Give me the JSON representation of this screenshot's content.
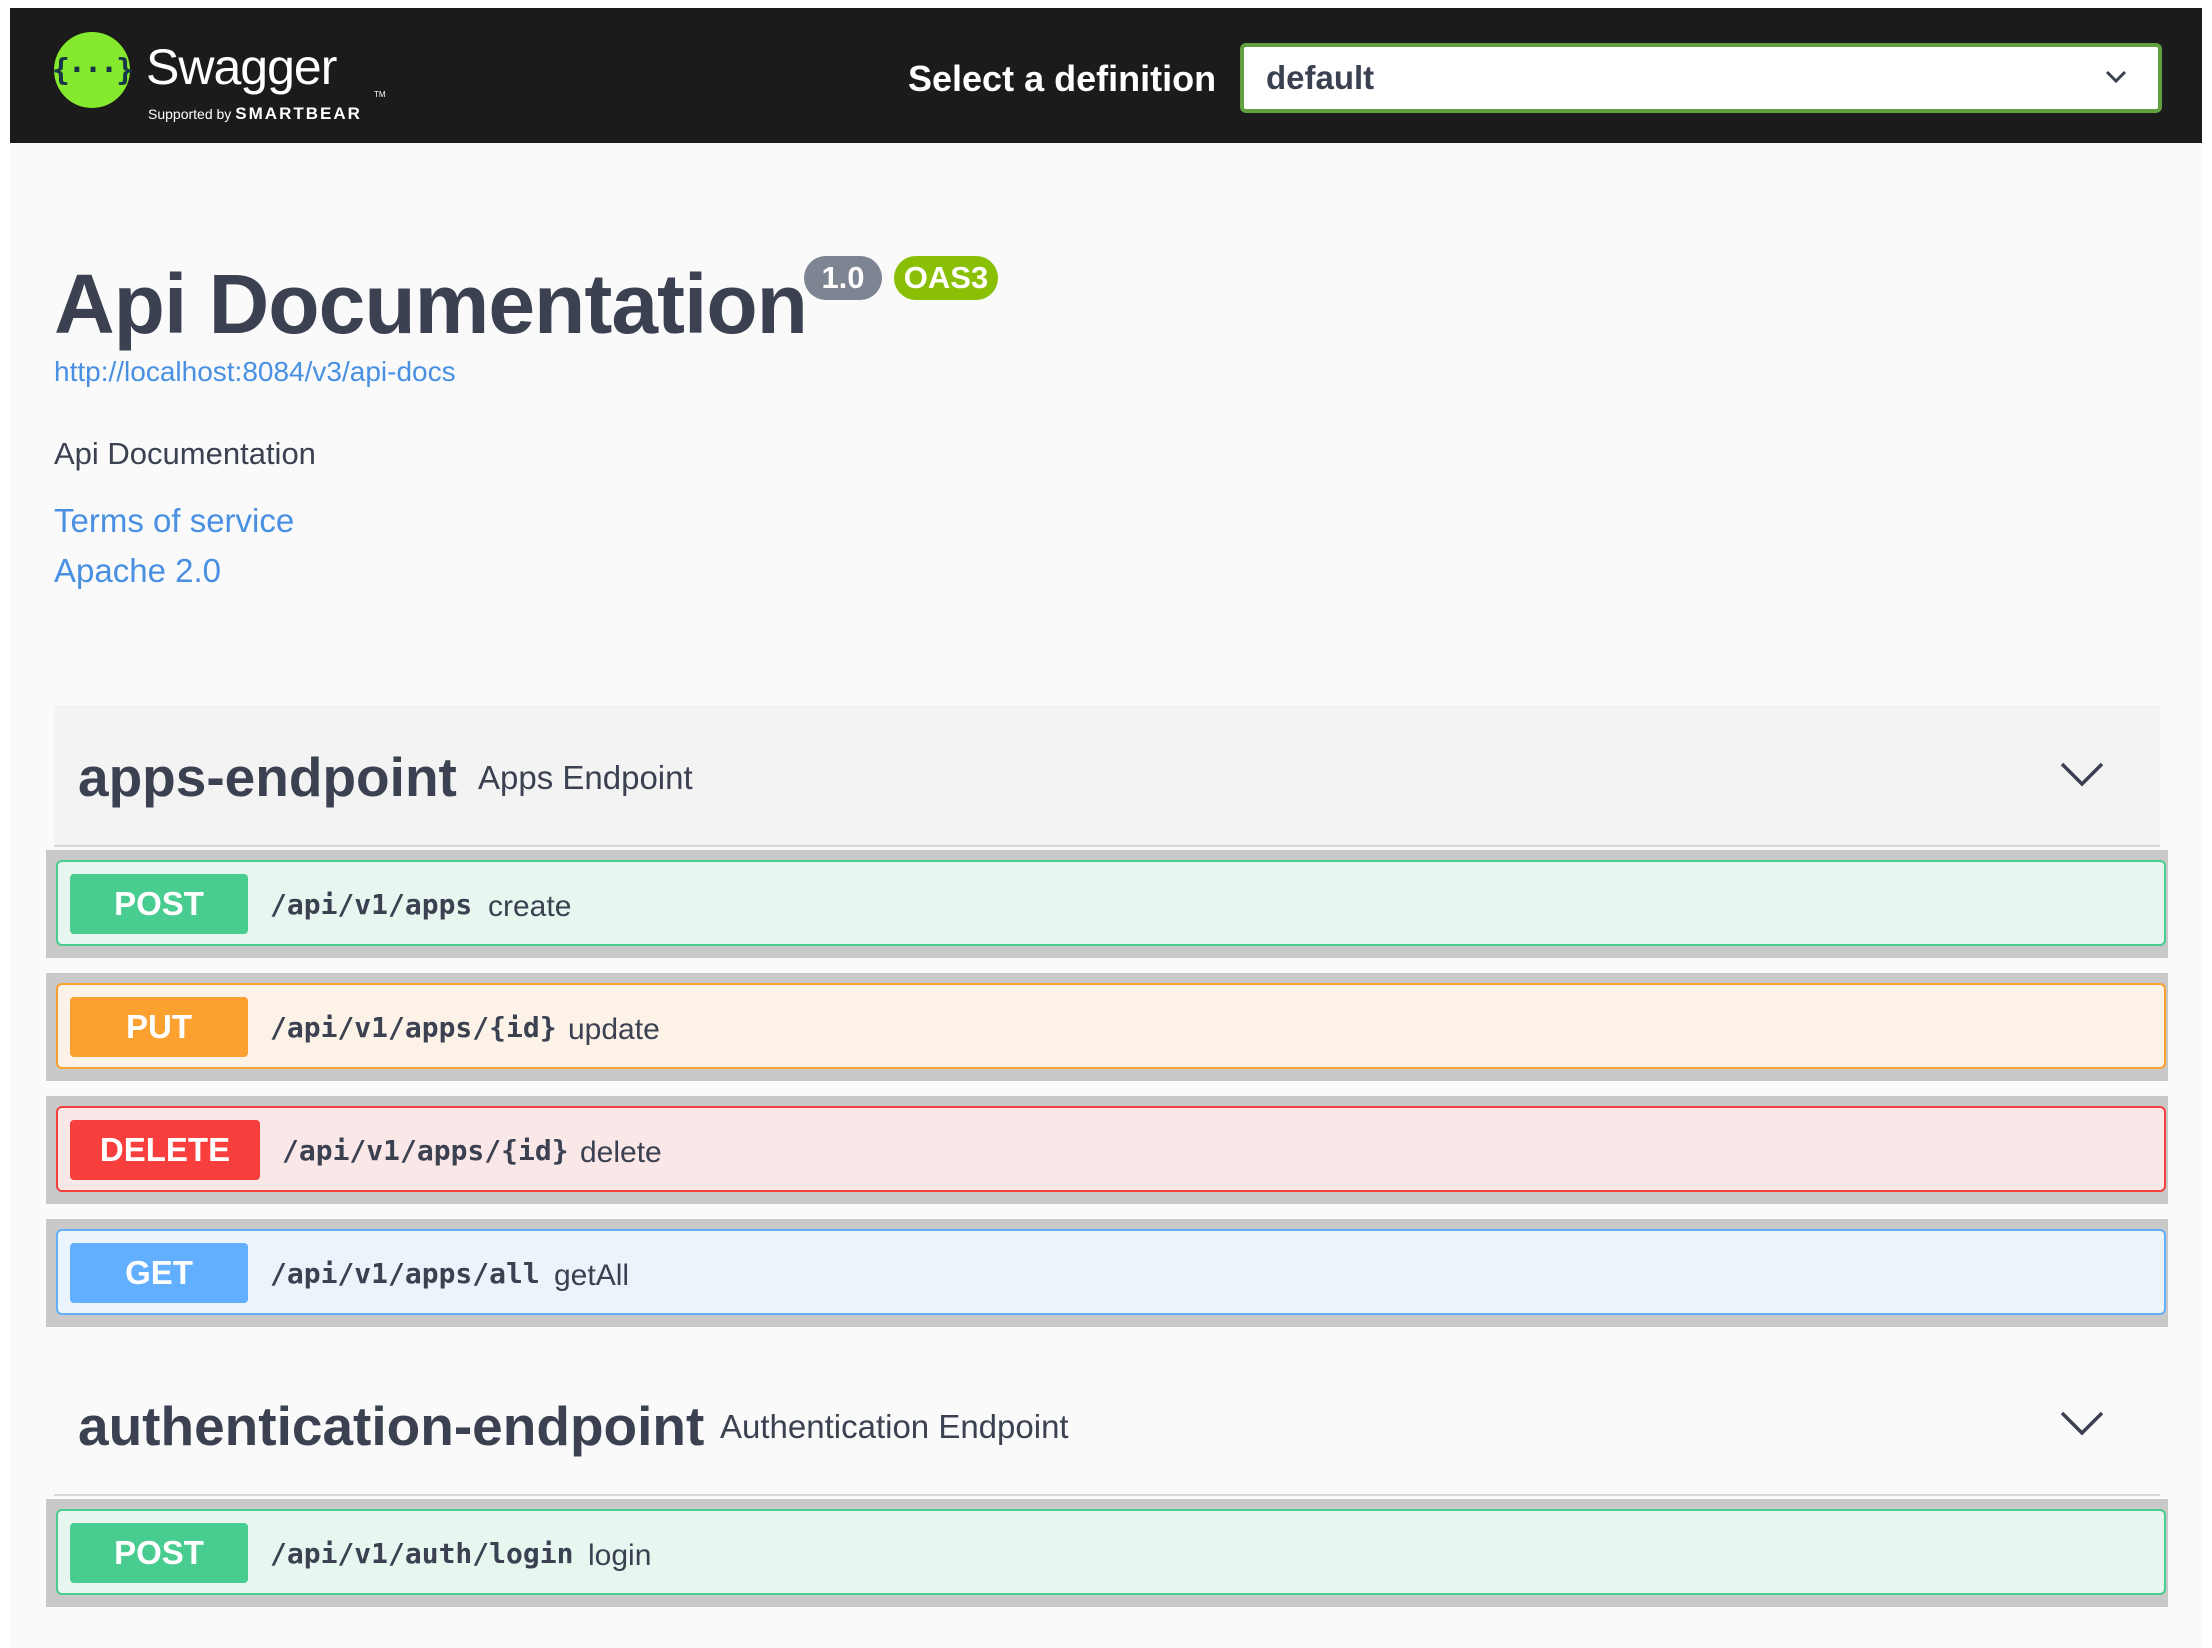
{
  "topbar": {
    "logo_text": "Swagger",
    "logo_supported_by": "Supported by",
    "logo_company": "SMARTBEAR",
    "select_label": "Select a definition",
    "select_value": "default"
  },
  "info": {
    "title": "Api Documentation",
    "version_badge": "1.0",
    "oas_badge": "OAS3",
    "spec_url": "http://localhost:8084/v3/api-docs",
    "description": "Api Documentation",
    "terms_link": "Terms of service",
    "license_link": "Apache 2.0"
  },
  "tags": [
    {
      "name": "apps-endpoint",
      "description": "Apps Endpoint",
      "operations": [
        {
          "method": "POST",
          "path": "/api/v1/apps",
          "summary": "create"
        },
        {
          "method": "PUT",
          "path": "/api/v1/apps/{id}",
          "summary": "update"
        },
        {
          "method": "DELETE",
          "path": "/api/v1/apps/{id}",
          "summary": "delete"
        },
        {
          "method": "GET",
          "path": "/api/v1/apps/all",
          "summary": "getAll"
        }
      ]
    },
    {
      "name": "authentication-endpoint",
      "description": "Authentication Endpoint",
      "operations": [
        {
          "method": "POST",
          "path": "/api/v1/auth/login",
          "summary": "login"
        }
      ]
    }
  ],
  "colors": {
    "topbar": "#1b1b1b",
    "logo_green": "#85ea2d",
    "post": "#49cc90",
    "put": "#fca130",
    "delete": "#f93e3e",
    "get": "#61affe",
    "link": "#4990e2"
  }
}
